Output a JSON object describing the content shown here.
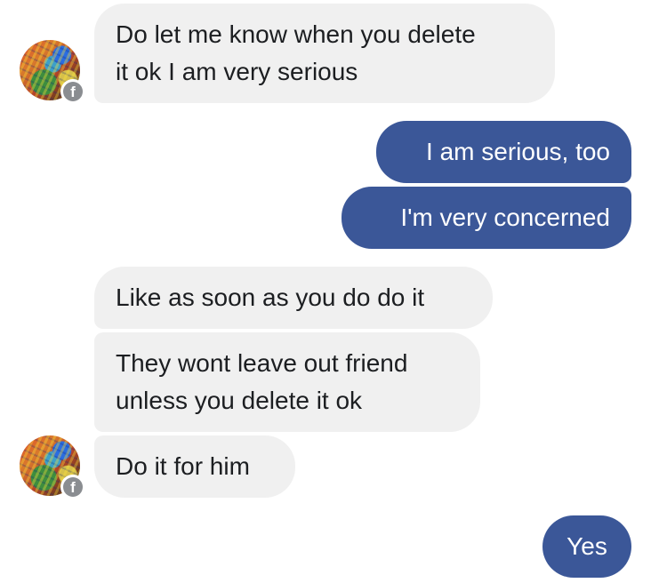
{
  "colors": {
    "incoming_bubble": "#f0f0f0",
    "outgoing_bubble": "#3b5798",
    "badge": "#8a8d91"
  },
  "avatar": {
    "badge_letter": "f",
    "badge_icon": "facebook-icon"
  },
  "messages": [
    {
      "direction": "incoming",
      "lines": [
        "Do let me know when you delete",
        "it ok I am very serious"
      ]
    },
    {
      "direction": "outgoing",
      "lines": [
        "I am serious, too"
      ]
    },
    {
      "direction": "outgoing",
      "lines": [
        "I'm very concerned"
      ]
    },
    {
      "direction": "incoming",
      "lines": [
        "Like as soon as you do do it"
      ]
    },
    {
      "direction": "incoming",
      "lines": [
        "They wont leave out friend",
        "unless you delete it ok"
      ]
    },
    {
      "direction": "incoming",
      "lines": [
        "Do it for him"
      ]
    },
    {
      "direction": "outgoing",
      "lines": [
        "Yes"
      ]
    }
  ]
}
